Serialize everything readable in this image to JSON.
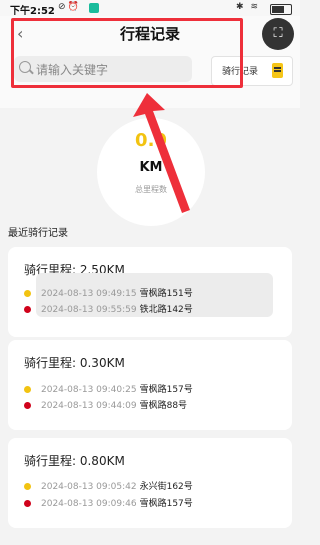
{
  "status_bar": {
    "time": "下午2:52"
  },
  "header": {
    "back_icon": "back-icon",
    "title": "行程记录",
    "corner_icon": "scan-text-icon"
  },
  "search": {
    "placeholder": "请输入关键字"
  },
  "record_button": {
    "label": "骑行记录",
    "icon": "document-icon"
  },
  "summary": {
    "value": "0.0",
    "unit": "KM",
    "label": "总里程数"
  },
  "section_title": "最近骑行记录",
  "records": [
    {
      "title": "骑行里程: 2.50KM",
      "start": {
        "time": "2024-08-13 09:49:15",
        "address": "雪枫路151号"
      },
      "end": {
        "time": "2024-08-13 09:55:59",
        "address": "铁北路142号"
      }
    },
    {
      "title": "骑行里程: 0.30KM",
      "start": {
        "time": "2024-08-13 09:40:25",
        "address": "雪枫路157号"
      },
      "end": {
        "time": "2024-08-13 09:44:09",
        "address": "雪枫路88号"
      }
    },
    {
      "title": "骑行里程: 0.80KM",
      "start": {
        "time": "2024-08-13 09:05:42",
        "address": "永兴街162号"
      },
      "end": {
        "time": "2024-08-13 09:09:46",
        "address": "雪枫路157号"
      }
    }
  ],
  "colors": {
    "accent_yellow": "#f2c311",
    "highlight_red": "#ee2f3a",
    "end_dot_red": "#d0021b"
  }
}
